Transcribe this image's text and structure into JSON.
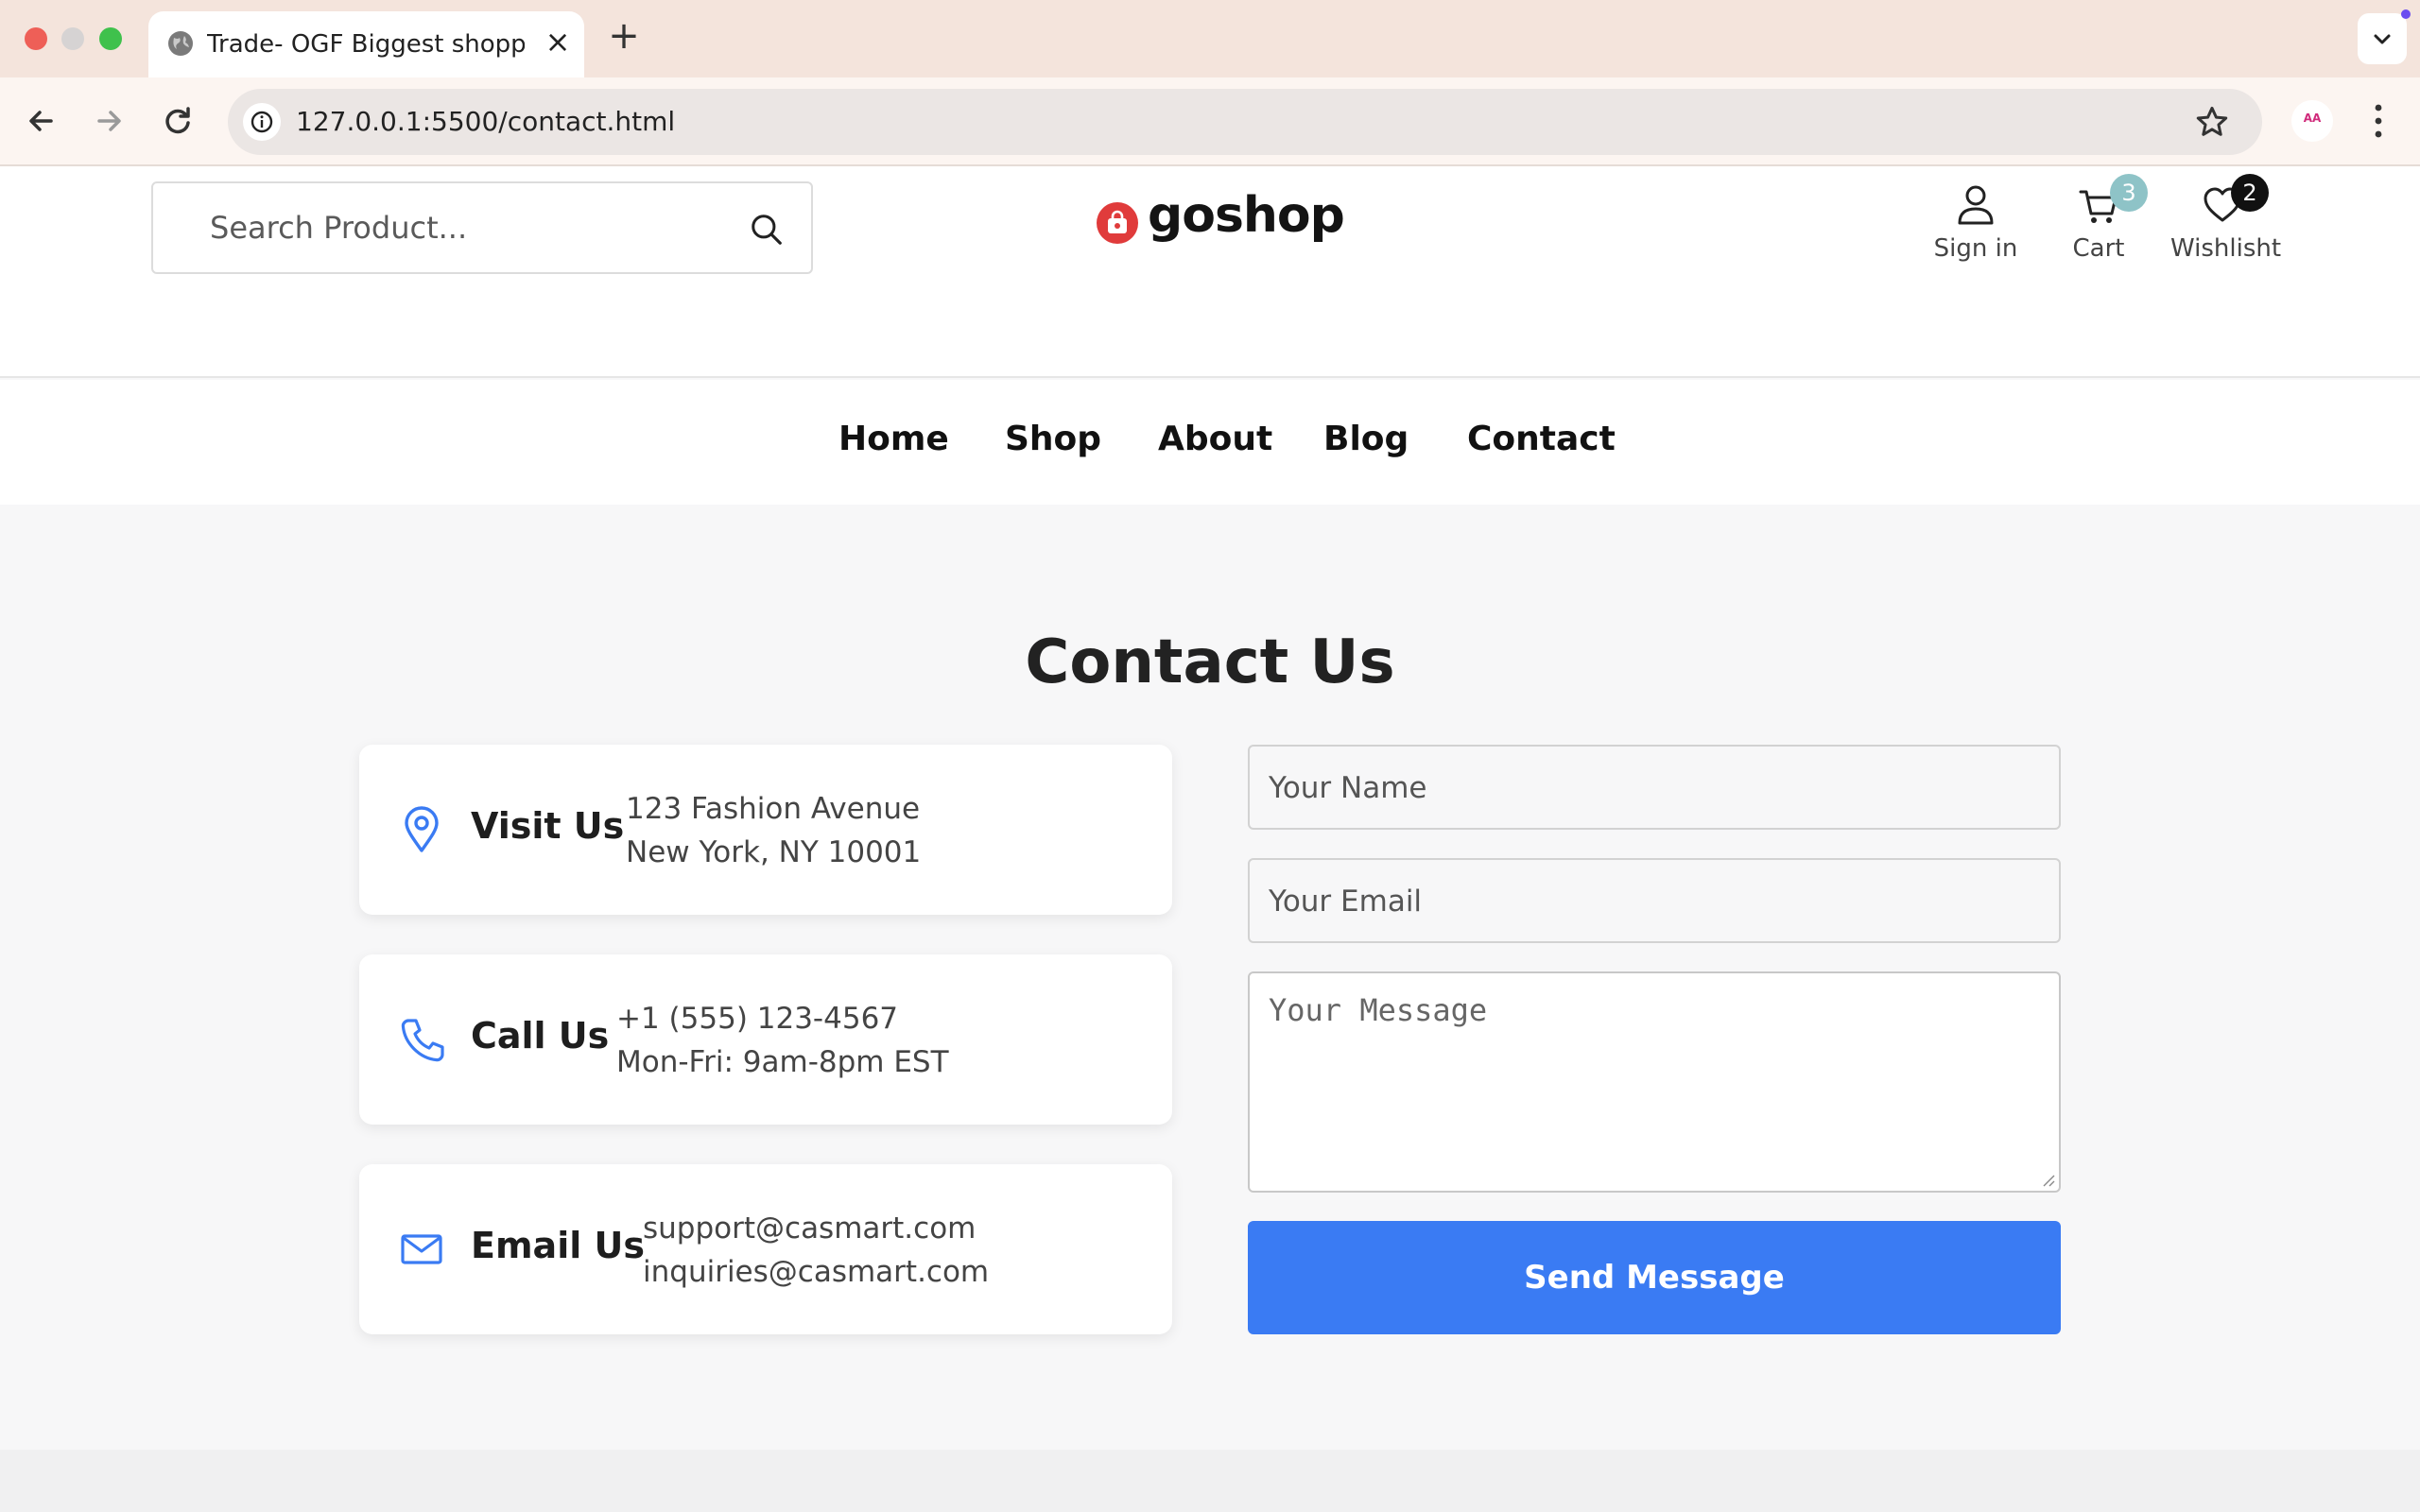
{
  "browser": {
    "tab_title": "Trade- OGF Biggest shopping",
    "tab_close_glyph": "×",
    "new_tab_glyph": "+",
    "url": "127.0.0.1:5500/contact.html",
    "profile_initials": "AA"
  },
  "header": {
    "search_placeholder": "Search Product...",
    "logo_text": "goshop",
    "actions": [
      {
        "label": "Sign in",
        "icon": "user-icon"
      },
      {
        "label": "Cart",
        "icon": "cart-icon",
        "count": "3"
      },
      {
        "label": "Wishlisht",
        "icon": "heart-icon",
        "count": "2"
      }
    ]
  },
  "nav": {
    "items": [
      "Home",
      "Shop",
      "About",
      "Blog",
      "Contact"
    ]
  },
  "contact": {
    "title": "Contact Us",
    "cards": [
      {
        "title": "Visit Us",
        "icon": "map-pin-icon",
        "lines": [
          "123 Fashion Avenue",
          "New York, NY 10001"
        ]
      },
      {
        "title": "Call Us",
        "icon": "phone-icon",
        "lines": [
          "+1 (555) 123-4567",
          "Mon-Fri: 9am-8pm EST"
        ]
      },
      {
        "title": "Email Us",
        "icon": "mail-icon",
        "lines": [
          "support@casmart.com",
          "inquiries@casmart.com"
        ]
      }
    ],
    "form": {
      "name_placeholder": "Your Name",
      "email_placeholder": "Your Email",
      "message_placeholder": "Your Message",
      "submit_label": "Send Message"
    }
  },
  "colors": {
    "accent": "#3a7bf3",
    "logo_red": "#e03b3b",
    "cart_badge": "#8ec3c7",
    "wishlist_badge": "#111111"
  }
}
